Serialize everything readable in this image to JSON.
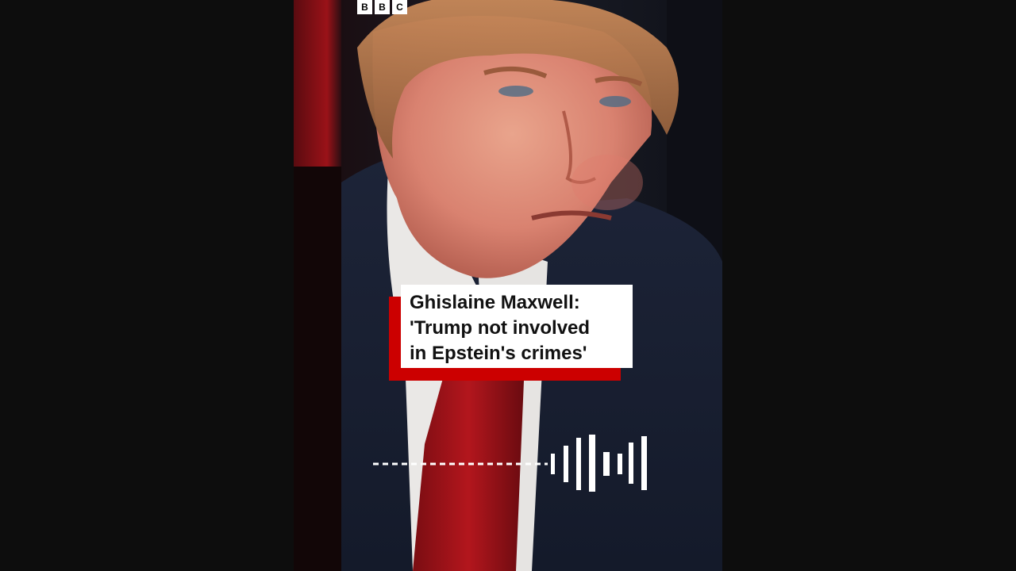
{
  "brand": {
    "logo_letters": [
      "B",
      "B",
      "C"
    ]
  },
  "headline": {
    "text": "Ghislaine Maxwell:\n'Trump not involved\nin Epstein's crimes'"
  },
  "colors": {
    "background": "#0d0d0d",
    "accent_red": "#cc0000",
    "headline_box": "#ffffff",
    "headline_text": "#111111",
    "visualizer": "#ffffff"
  },
  "icons": {
    "audio_visualizer": "audio-waveform-icon"
  }
}
